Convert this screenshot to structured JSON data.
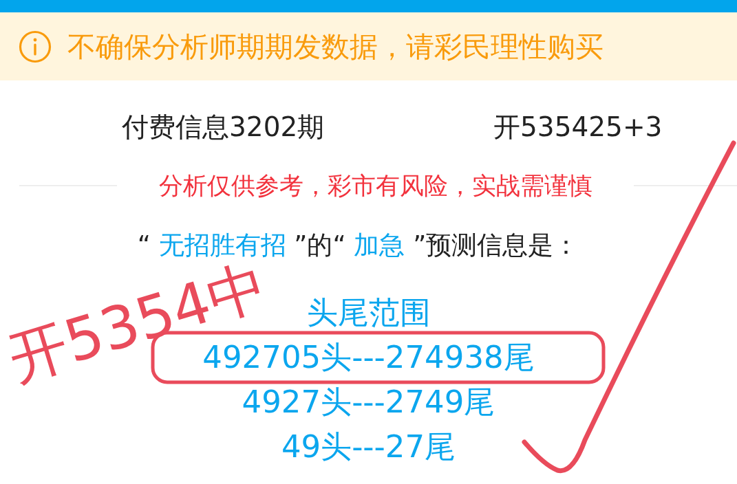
{
  "notice": {
    "text": "不确保分析师期期发数据，请彩民理性购买"
  },
  "header": {
    "issue": "付费信息3202期",
    "result": "开535425+3"
  },
  "disclaimer": "分析仅供参考，彩市有风险，实战需谨慎",
  "intro": [
    {
      "kind": "plain",
      "text": "“"
    },
    {
      "kind": "highlight",
      "text": " 无招胜有招 "
    },
    {
      "kind": "plain",
      "text": "”的“"
    },
    {
      "kind": "highlight",
      "text": " 加急 "
    },
    {
      "kind": "plain",
      "text": "”预测信息是："
    }
  ],
  "prediction": {
    "title": "头尾范围",
    "lines": [
      "492705头---274938尾",
      "4927头---2749尾",
      "49头---27尾"
    ]
  },
  "annotations": [
    {
      "kind": "handwriting",
      "text": "开5354中"
    },
    {
      "kind": "box"
    },
    {
      "kind": "check"
    }
  ]
}
